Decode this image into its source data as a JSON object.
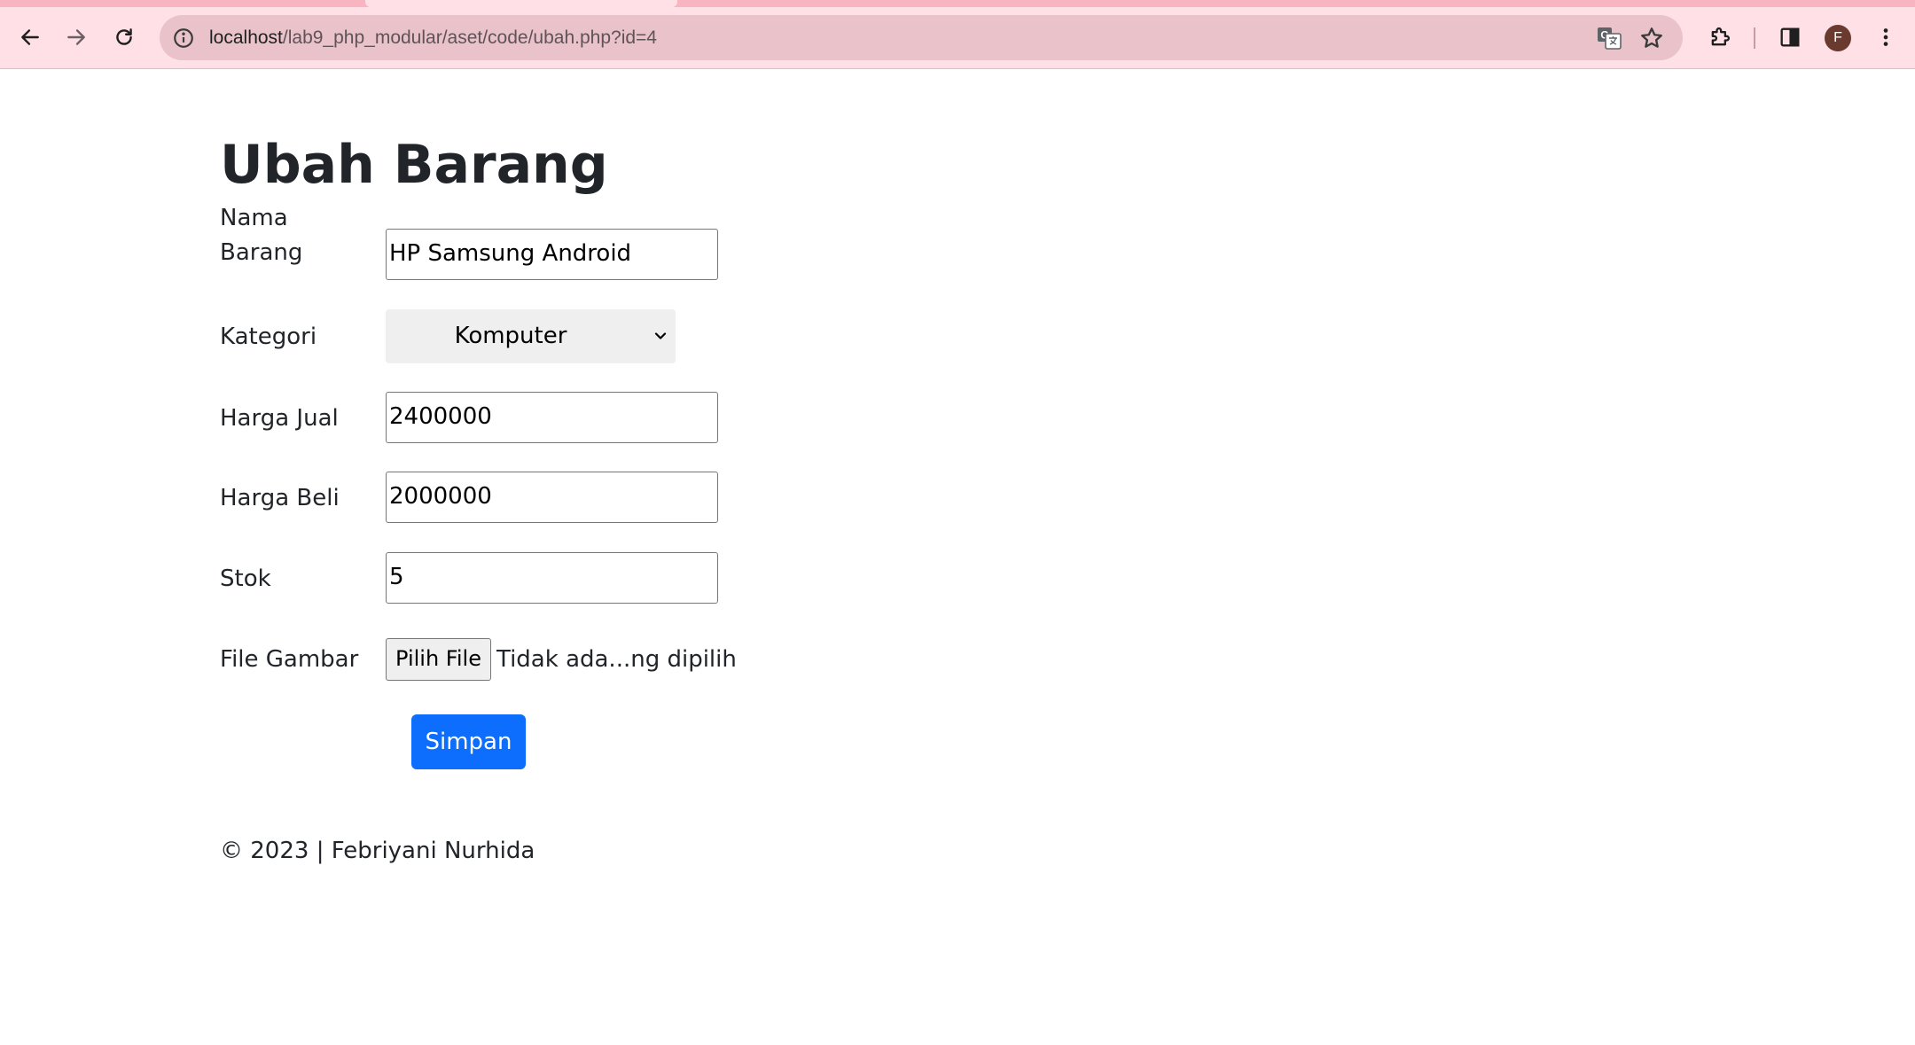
{
  "browser": {
    "url_host": "localhost",
    "url_path": "/lab9_php_modular/aset/code/ubah.php?id=4",
    "profile_initial": "F",
    "icons": [
      "back-arrow-icon",
      "forward-arrow-icon",
      "reload-icon",
      "site-info-icon",
      "translate-icon",
      "bookmark-star-icon",
      "extensions-icon",
      "side-panel-icon",
      "more-menu-icon"
    ]
  },
  "page": {
    "title": "Ubah Barang",
    "form": {
      "nama_label": "Nama Barang",
      "nama_value": "HP Samsung Android",
      "kategori_label": "Kategori",
      "kategori_value": "Komputer",
      "harga_jual_label": "Harga Jual",
      "harga_jual_value": "2400000",
      "harga_beli_label": "Harga Beli",
      "harga_beli_value": "2000000",
      "stok_label": "Stok",
      "stok_value": "5",
      "file_label": "File Gambar",
      "file_button_label": "Pilih File",
      "file_status": "Tidak ada...ng dipilih",
      "submit_label": "Simpan"
    },
    "footer": "© 2023 | Febriyani Nurhida"
  },
  "colors": {
    "chrome_bg": "#ffe0e6",
    "omnibox_bg": "#e9c2ca",
    "primary_button": "#0d6efd",
    "text": "#212529"
  }
}
